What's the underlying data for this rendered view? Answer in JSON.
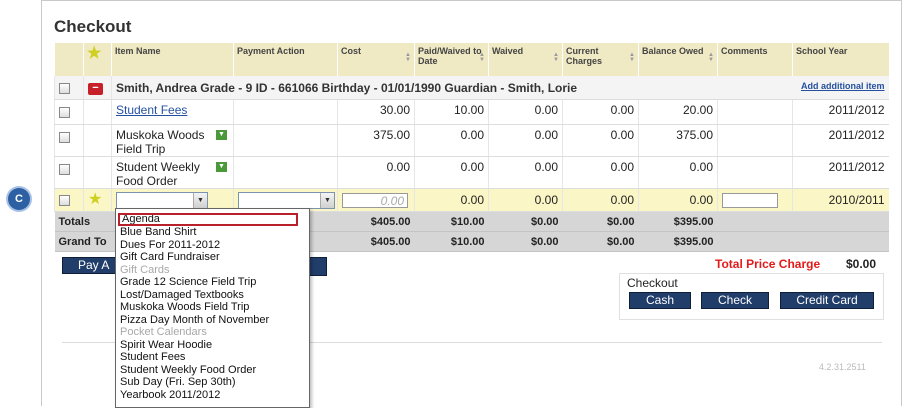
{
  "page": {
    "title": "Checkout"
  },
  "annotation": {
    "badge": "C"
  },
  "columns": [
    "Item Name",
    "Payment Action",
    "Cost",
    "Paid/Waived to Date",
    "Waived",
    "Current Charges",
    "Balance Owed",
    "Comments",
    "School Year"
  ],
  "student": {
    "name_line": "Smith, Andrea Grade - 9 ID - 661066 Birthday - 01/01/1990 Guardian - Smith, Lorie",
    "add_item_link": "Add additional item"
  },
  "items": [
    {
      "name": "Student Fees",
      "is_link": true,
      "cost": "30.00",
      "paid": "10.00",
      "waived": "0.00",
      "current": "0.00",
      "balance": "20.00",
      "year": "2011/2012"
    },
    {
      "name": "Muskoka Woods Field Trip",
      "cost": "375.00",
      "paid": "0.00",
      "waived": "0.00",
      "current": "0.00",
      "balance": "375.00",
      "year": "2011/2012"
    },
    {
      "name": "Student Weekly Food Order",
      "cost": "0.00",
      "paid": "0.00",
      "waived": "0.00",
      "current": "0.00",
      "balance": "0.00",
      "year": "2011/2012"
    }
  ],
  "new_row": {
    "cost_placeholder": "0.00",
    "paid": "0.00",
    "waived": "0.00",
    "current": "0.00",
    "balance": "0.00",
    "year": "2010/2011"
  },
  "totals": {
    "label": "Totals",
    "cost": "$405.00",
    "paid": "$10.00",
    "waived": "$0.00",
    "current": "$0.00",
    "balance": "$395.00"
  },
  "grand_total": {
    "label": "Grand To",
    "cost": "$405.00",
    "paid": "$10.00",
    "waived": "$0.00",
    "current": "$0.00",
    "balance": "$395.00"
  },
  "pay_button": "Pay A",
  "total_price": {
    "label": "Total Price Charge",
    "value": "$0.00"
  },
  "checkout": {
    "label": "Checkout",
    "cash": "Cash",
    "check": "Check",
    "credit": "Credit Card"
  },
  "version": "4.2.31.2511",
  "dropdown": {
    "selected": "Agenda",
    "options": [
      {
        "label": "Blue Band Shirt",
        "group": false
      },
      {
        "label": "Dues For 2011-2012",
        "group": false
      },
      {
        "label": "Gift Card Fundraiser",
        "group": false
      },
      {
        "label": "Gift Cards",
        "group": true
      },
      {
        "label": "Grade 12 Science Field Trip",
        "group": false
      },
      {
        "label": "Lost/Damaged Textbooks",
        "group": false
      },
      {
        "label": "Muskoka Woods Field Trip",
        "group": false
      },
      {
        "label": "Pizza Day Month of November",
        "group": false
      },
      {
        "label": "Pocket Calendars",
        "group": true
      },
      {
        "label": "Spirit Wear Hoodie",
        "group": false
      },
      {
        "label": "Student Fees",
        "group": false
      },
      {
        "label": "Student Weekly Food Order",
        "group": false
      },
      {
        "label": "Sub Day (Fri. Sep 30th)",
        "group": false
      },
      {
        "label": "Yearbook 2011/2012",
        "group": false
      }
    ]
  }
}
